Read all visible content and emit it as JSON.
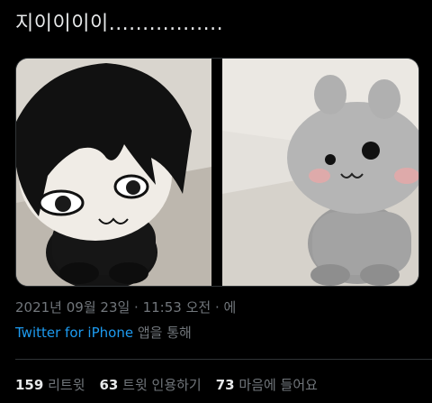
{
  "tweet": {
    "text": "지이이이이.................",
    "timestamp": "2021년 09월 23일 · 11:53 오전 · 에",
    "source_app": "Twitter for iPhone",
    "source_suffix": "앱을 통해"
  },
  "media": [
    {
      "icon": "black-plush-doll-photo"
    },
    {
      "icon": "gray-plush-doll-photo"
    }
  ],
  "stats": [
    {
      "value": "159",
      "label": "리트윗"
    },
    {
      "value": "63",
      "label": "트윗 인용하기"
    },
    {
      "value": "73",
      "label": "마음에 들어요"
    }
  ],
  "colors": {
    "background": "#000000",
    "text": "#e7e9ea",
    "muted": "#71767b",
    "link": "#1d9bf0"
  }
}
